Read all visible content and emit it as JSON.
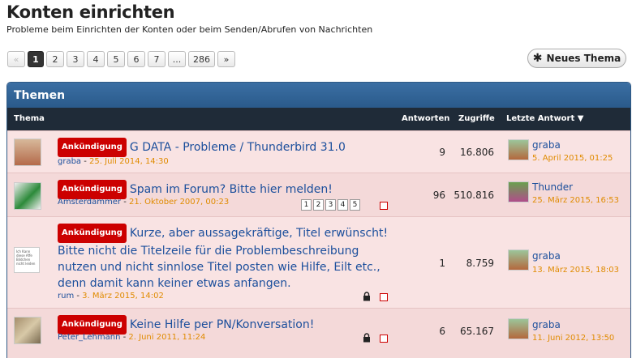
{
  "header": {
    "title": "Konten einrichten",
    "subtitle": "Probleme beim Einrichten der Konten oder beim Senden/Abrufen von Nachrichten"
  },
  "pagination": {
    "prev": "«",
    "pages": [
      "1",
      "2",
      "3",
      "4",
      "5",
      "6",
      "7",
      "...",
      "286"
    ],
    "next": "»",
    "current": "1"
  },
  "new_button": {
    "label": "Neues Thema",
    "icon": "asterisk-icon"
  },
  "panel": {
    "title": "Themen",
    "columns": {
      "topic": "Thema",
      "replies": "Antworten",
      "views": "Zugriffe",
      "last": "Letzte Antwort"
    }
  },
  "threads": [
    {
      "badge": "Ankündigung",
      "title": "G DATA - Probleme / Thunderbird 31.0",
      "author": "graba",
      "date": "25. Juli 2014, 14:30",
      "replies": "9",
      "views": "16.806",
      "last_user": "graba",
      "last_date": "5. April 2015, 01:25"
    },
    {
      "badge": "Ankündigung",
      "title": "Spam im Forum? Bitte hier melden!",
      "author": "Amsterdammer",
      "date": "21. Oktober 2007, 00:23",
      "replies": "96",
      "views": "510.816",
      "last_user": "Thunder",
      "last_date": "25. März 2015, 16:53",
      "mini_pages": [
        "1",
        "2",
        "3",
        "4",
        "5"
      ]
    },
    {
      "badge": "Ankündigung",
      "title_lines": [
        "Kurze, aber aussagekräftige, Titel erwünscht!",
        "Bitte nicht die Titelzeile für die Problembeschreibung",
        "nutzen und nicht sinnlose Titel posten wie Hilfe, Eilt etc.,",
        "denn damit kann keiner etwas anfangen."
      ],
      "author": "rum",
      "date": "3. März 2015, 14:02",
      "replies": "1",
      "views": "8.759",
      "last_user": "graba",
      "last_date": "13. März 2015, 18:03",
      "avatar_text": "Ich Kann diese Affe Bildchen nicht leiden"
    },
    {
      "badge": "Ankündigung",
      "title": "Keine Hilfe per PN/Konversation!",
      "author": "Peter_Lehmann",
      "date": "2. Juni 2011, 11:24",
      "replies": "6",
      "views": "65.167",
      "last_user": "graba",
      "last_date": "11. Juni 2012, 13:50"
    }
  ]
}
